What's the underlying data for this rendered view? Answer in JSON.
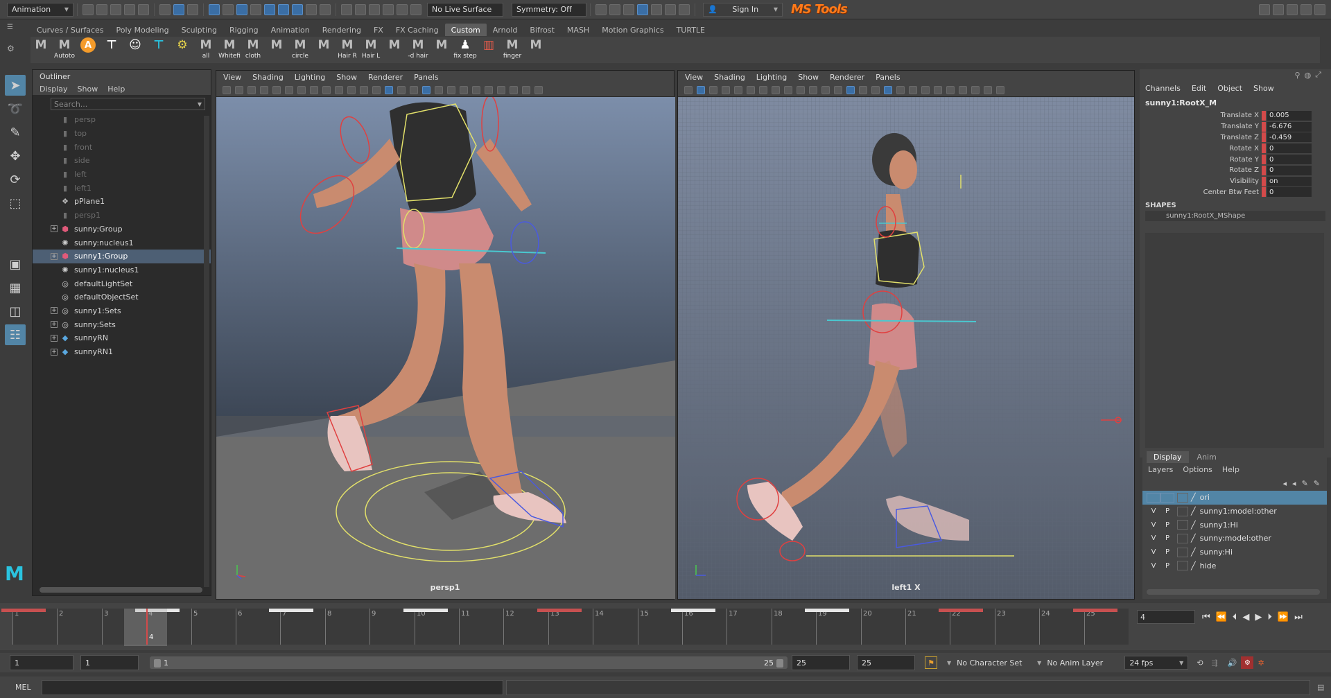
{
  "status_line": {
    "mode": "Animation",
    "live_surface": "No Live Surface",
    "symmetry": "Symmetry: Off",
    "sign_in": "Sign In",
    "brand": "MS Tools"
  },
  "shelf": {
    "tabs": [
      "Curves / Surfaces",
      "Poly Modeling",
      "Sculpting",
      "Rigging",
      "Animation",
      "Rendering",
      "FX",
      "FX Caching",
      "Custom",
      "Arnold",
      "Bifrost",
      "MASH",
      "Motion Graphics",
      "TURTLE"
    ],
    "active_tab": "Custom",
    "buttons": [
      {
        "glyph": "M",
        "label": ""
      },
      {
        "glyph": "M",
        "label": "Autoto"
      },
      {
        "glyph": "A",
        "label": ""
      },
      {
        "glyph": "⊤",
        "label": ""
      },
      {
        "glyph": "☺",
        "label": ""
      },
      {
        "glyph": "⊤",
        "label": ""
      },
      {
        "glyph": "⚙",
        "label": ""
      },
      {
        "glyph": "M",
        "label": "all"
      },
      {
        "glyph": "M",
        "label": "Whitefi"
      },
      {
        "glyph": "M",
        "label": "cloth"
      },
      {
        "glyph": "M",
        "label": ""
      },
      {
        "glyph": "M",
        "label": "circle"
      },
      {
        "glyph": "M",
        "label": ""
      },
      {
        "glyph": "M",
        "label": "Hair R"
      },
      {
        "glyph": "M",
        "label": "Hair L"
      },
      {
        "glyph": "M",
        "label": ""
      },
      {
        "glyph": "M",
        "label": "-d hair"
      },
      {
        "glyph": "M",
        "label": ""
      },
      {
        "glyph": "♟",
        "label": "fix step"
      },
      {
        "glyph": "▥",
        "label": ""
      },
      {
        "glyph": "M",
        "label": "finger"
      },
      {
        "glyph": "M",
        "label": ""
      }
    ]
  },
  "outliner": {
    "title": "Outliner",
    "menus": [
      "Display",
      "Show",
      "Help"
    ],
    "search_placeholder": "Search...",
    "items": [
      {
        "label": "persp",
        "icon": "camera",
        "dim": true,
        "expand": false
      },
      {
        "label": "top",
        "icon": "camera",
        "dim": true,
        "expand": false
      },
      {
        "label": "front",
        "icon": "camera",
        "dim": true,
        "expand": false
      },
      {
        "label": "side",
        "icon": "camera",
        "dim": true,
        "expand": false
      },
      {
        "label": "left",
        "icon": "camera",
        "dim": true,
        "expand": false
      },
      {
        "label": "left1",
        "icon": "camera",
        "dim": true,
        "expand": false
      },
      {
        "label": "pPlane1",
        "icon": "mesh",
        "dim": false,
        "expand": false
      },
      {
        "label": "persp1",
        "icon": "camera",
        "dim": true,
        "expand": false
      },
      {
        "label": "sunny:Group",
        "icon": "group",
        "dim": false,
        "expand": true
      },
      {
        "label": "sunny:nucleus1",
        "icon": "nucleus",
        "dim": false,
        "expand": false
      },
      {
        "label": "sunny1:Group",
        "icon": "group",
        "dim": false,
        "expand": true,
        "selected": true
      },
      {
        "label": "sunny1:nucleus1",
        "icon": "nucleus",
        "dim": false,
        "expand": false
      },
      {
        "label": "defaultLightSet",
        "icon": "set",
        "dim": false,
        "expand": false
      },
      {
        "label": "defaultObjectSet",
        "icon": "set",
        "dim": false,
        "expand": false
      },
      {
        "label": "sunny1:Sets",
        "icon": "set",
        "dim": false,
        "expand": true
      },
      {
        "label": "sunny:Sets",
        "icon": "set",
        "dim": false,
        "expand": true
      },
      {
        "label": "sunnyRN",
        "icon": "ref",
        "dim": false,
        "expand": true
      },
      {
        "label": "sunnyRN1",
        "icon": "ref",
        "dim": false,
        "expand": true
      }
    ]
  },
  "viewport_left": {
    "menus": [
      "View",
      "Shading",
      "Lighting",
      "Show",
      "Renderer",
      "Panels"
    ],
    "camera": "persp1"
  },
  "viewport_right": {
    "menus": [
      "View",
      "Shading",
      "Lighting",
      "Show",
      "Renderer",
      "Panels"
    ],
    "camera": "left1 X"
  },
  "channel_box": {
    "menus": [
      "Channels",
      "Edit",
      "Object",
      "Show"
    ],
    "object": "sunny1:RootX_M",
    "attributes": [
      {
        "name": "Translate X",
        "value": "0.005",
        "keyed": true
      },
      {
        "name": "Translate Y",
        "value": "-6.676",
        "keyed": true
      },
      {
        "name": "Translate Z",
        "value": "-0.459",
        "keyed": true
      },
      {
        "name": "Rotate X",
        "value": "0",
        "keyed": true
      },
      {
        "name": "Rotate Y",
        "value": "0",
        "keyed": true
      },
      {
        "name": "Rotate Z",
        "value": "0",
        "keyed": true
      },
      {
        "name": "Visibility",
        "value": "on",
        "keyed": true
      },
      {
        "name": "Center Btw Feet",
        "value": "0",
        "keyed": true
      }
    ],
    "shapes_header": "SHAPES",
    "shape": "sunny1:RootX_MShape"
  },
  "layers": {
    "tabs": [
      "Display",
      "Anim"
    ],
    "active_tab": "Display",
    "menus": [
      "Layers",
      "Options",
      "Help"
    ],
    "rows": [
      {
        "v": "",
        "p": "",
        "name": "ori",
        "selected": true
      },
      {
        "v": "V",
        "p": "P",
        "name": "sunny1:model:other"
      },
      {
        "v": "V",
        "p": "P",
        "name": "sunny1:Hi"
      },
      {
        "v": "V",
        "p": "P",
        "name": "sunny:model:other"
      },
      {
        "v": "V",
        "p": "P",
        "name": "sunny:Hi"
      },
      {
        "v": "V",
        "p": "P",
        "name": "hide"
      }
    ]
  },
  "timeline": {
    "frames": [
      "1",
      "2",
      "3",
      "4",
      "5",
      "6",
      "7",
      "8",
      "9",
      "10",
      "11",
      "12",
      "13",
      "14",
      "15",
      "16",
      "17",
      "18",
      "19",
      "20",
      "21",
      "22",
      "23",
      "24",
      "25"
    ],
    "current_frame": "4",
    "current_field": "4",
    "key_colors": {
      "red": "#c75050",
      "white": "#e6e6e6"
    }
  },
  "range": {
    "start": "1",
    "anim_start": "1",
    "slider_start": "1",
    "slider_end": "25",
    "anim_end": "25",
    "end": "25",
    "character_set": "No Character Set",
    "anim_layer": "No Anim Layer",
    "fps": "24 fps"
  },
  "command_line": {
    "label": "MEL"
  }
}
